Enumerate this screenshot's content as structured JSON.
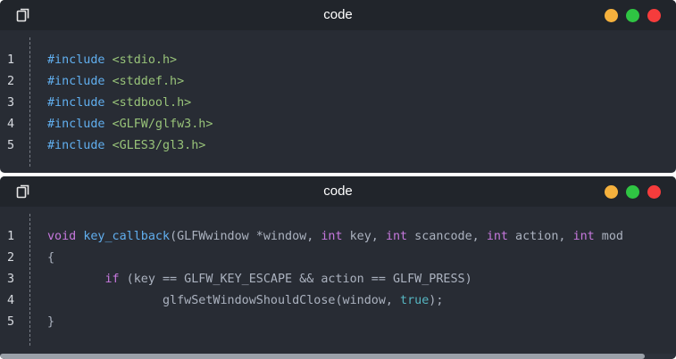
{
  "windows": [
    {
      "title": "code",
      "lines": [
        {
          "num": "1",
          "tokens": [
            {
              "t": "#include ",
              "c": "pp"
            },
            {
              "t": "<stdio.h>",
              "c": "str"
            }
          ]
        },
        {
          "num": "2",
          "tokens": [
            {
              "t": "#include ",
              "c": "pp"
            },
            {
              "t": "<stddef.h>",
              "c": "str"
            }
          ]
        },
        {
          "num": "3",
          "tokens": [
            {
              "t": "#include ",
              "c": "pp"
            },
            {
              "t": "<stdbool.h>",
              "c": "str"
            }
          ]
        },
        {
          "num": "4",
          "tokens": [
            {
              "t": "#include ",
              "c": "pp"
            },
            {
              "t": "<GLFW/glfw3.h>",
              "c": "str"
            }
          ]
        },
        {
          "num": "5",
          "tokens": [
            {
              "t": "#include ",
              "c": "pp"
            },
            {
              "t": "<GLES3/gl3.h>",
              "c": "str"
            }
          ]
        }
      ]
    },
    {
      "title": "code",
      "lines": [
        {
          "num": "1",
          "tokens": [
            {
              "t": "void",
              "c": "kw"
            },
            {
              "t": " ",
              "c": "plain"
            },
            {
              "t": "key_callback",
              "c": "fn"
            },
            {
              "t": "(GLFWwindow *window, ",
              "c": "plain"
            },
            {
              "t": "int",
              "c": "kw"
            },
            {
              "t": " key, ",
              "c": "plain"
            },
            {
              "t": "int",
              "c": "kw"
            },
            {
              "t": " scancode, ",
              "c": "plain"
            },
            {
              "t": "int",
              "c": "kw"
            },
            {
              "t": " action, ",
              "c": "plain"
            },
            {
              "t": "int",
              "c": "kw"
            },
            {
              "t": " mod",
              "c": "plain"
            }
          ]
        },
        {
          "num": "2",
          "tokens": [
            {
              "t": "{",
              "c": "plain"
            }
          ]
        },
        {
          "num": "3",
          "tokens": [
            {
              "t": "        ",
              "c": "plain"
            },
            {
              "t": "if",
              "c": "kw"
            },
            {
              "t": " (key == GLFW_KEY_ESCAPE && action == GLFW_PRESS)",
              "c": "plain"
            }
          ]
        },
        {
          "num": "4",
          "tokens": [
            {
              "t": "                glfwSetWindowShouldClose(window, ",
              "c": "plain"
            },
            {
              "t": "true",
              "c": "lit"
            },
            {
              "t": ");",
              "c": "plain"
            }
          ]
        },
        {
          "num": "5",
          "tokens": [
            {
              "t": "}",
              "c": "plain"
            }
          ]
        }
      ]
    }
  ],
  "icons": {
    "copy": "copy-icon",
    "window_controls": [
      "minimize-dot",
      "maximize-dot",
      "close-dot"
    ]
  },
  "colors": {
    "minimize": "#f5b13d",
    "maximize": "#2fc543",
    "close": "#f63c3c",
    "preprocessor": "#61afef",
    "string": "#98c379",
    "keyword": "#c678dd",
    "function": "#61afef",
    "literal": "#56b6c2",
    "plain": "#abb2bf"
  }
}
